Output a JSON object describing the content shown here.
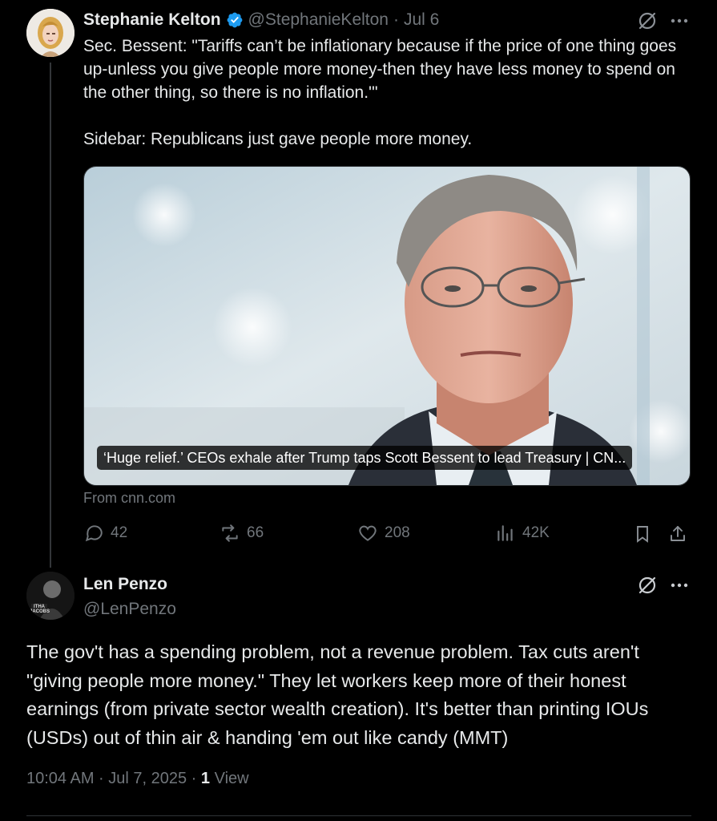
{
  "tweet1": {
    "display_name": "Stephanie Kelton",
    "handle": "@StephanieKelton",
    "separator": "·",
    "date": "Jul 6",
    "verified": true,
    "text_para1": "Sec. Bessent: \"Tariffs can’t be inflationary because if the price of one thing goes up-unless you give people more money-then they have less money to spend on the other thing, so there is no inflation.'\"",
    "text_para2": "Sidebar: Republicans just gave people more money.",
    "card": {
      "caption": "‘Huge relief.’ CEOs exhale after Trump taps Scott Bessent to lead Treasury | CN...",
      "source": "From cnn.com"
    },
    "stats": {
      "replies": "42",
      "reposts": "66",
      "likes": "208",
      "views": "42K"
    }
  },
  "tweet2": {
    "display_name": "Len Penzo",
    "handle": "@LenPenzo",
    "avatar_text": "ITHA JACOBS",
    "text": "The gov't has a spending problem, not a revenue problem. Tax cuts aren't \"giving people more money.\" They let workers keep more of their honest earnings (from private sector wealth creation). It's better than printing IOUs (USDs) out of thin air & handing 'em out like candy (MMT)",
    "time": "10:04 AM · Jul 7, 2025 · ",
    "view_count": "1",
    "view_label": " View"
  },
  "icons": {
    "grok": "grok-icon",
    "more": "more-icon",
    "reply": "reply-icon",
    "repost": "repost-icon",
    "like": "like-icon",
    "views": "views-icon",
    "bookmark": "bookmark-icon",
    "share": "share-icon"
  },
  "colors": {
    "background": "#000000",
    "text": "#e7e9ea",
    "muted": "#71767b",
    "verified": "#1d9bf0"
  }
}
